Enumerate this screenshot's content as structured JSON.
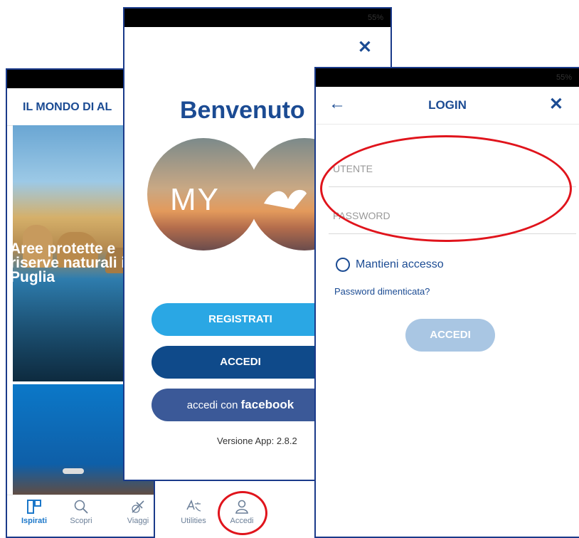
{
  "screen_home": {
    "status": "",
    "header_title": "IL MONDO DI AL",
    "card_title": "Aree protette e riserve naturali in Puglia",
    "tabs": [
      {
        "label": "Ispirati",
        "icon": "inspire-icon",
        "active": true
      },
      {
        "label": "Scopri",
        "icon": "search-icon",
        "active": false
      },
      {
        "label": "Viaggi",
        "icon": "plane-icon",
        "active": false
      },
      {
        "label": "Utilities",
        "icon": "translate-icon",
        "active": false
      },
      {
        "label": "Accedi",
        "icon": "user-icon",
        "active": false
      }
    ]
  },
  "screen_welcome": {
    "status": "55%",
    "close_glyph": "✕",
    "title": "Benvenuto",
    "logo_text": "MY",
    "register_label": "REGISTRATI",
    "login_label": "ACCEDI",
    "facebook_prefix": "accedi con",
    "facebook_brand": "facebook",
    "version": "Versione App: 2.8.2"
  },
  "screen_login": {
    "status": "55%",
    "back_glyph": "←",
    "title": "LOGIN",
    "close_glyph": "✕",
    "username_placeholder": "UTENTE",
    "password_placeholder": "PASSWORD",
    "remember_label": "Mantieni accesso",
    "forgot_label": "Password dimenticata?",
    "submit_label": "ACCEDI"
  },
  "colors": {
    "primary": "#1b4b93",
    "register": "#2aa7e4",
    "login": "#0f4a8a",
    "facebook": "#3b5998",
    "disabled_button": "#a9c6e3",
    "highlight": "#e0141c"
  }
}
